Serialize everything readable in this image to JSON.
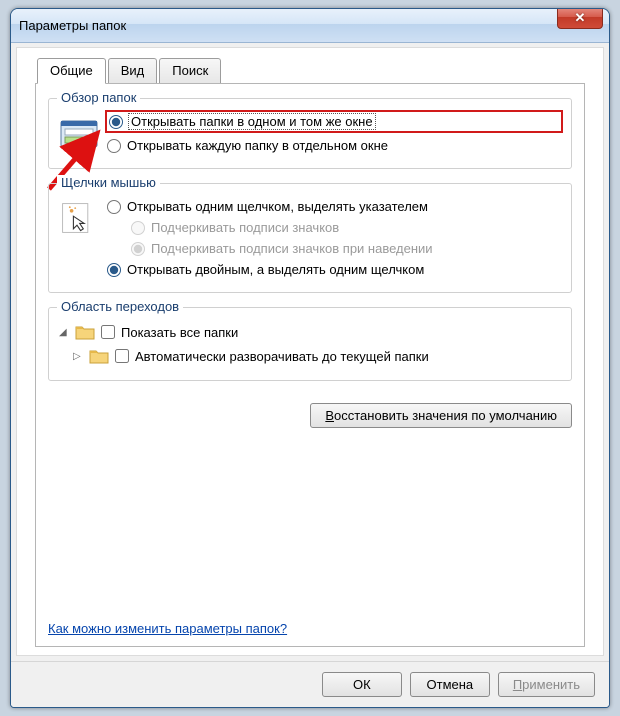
{
  "window": {
    "title": "Параметры папок"
  },
  "tabs": {
    "general": "Общие",
    "view": "Вид",
    "search": "Поиск"
  },
  "group1": {
    "title": "Обзор папок",
    "opt1": "Открывать папки в одном и том же окне",
    "opt2": "Открывать каждую папку в отдельном окне"
  },
  "group2": {
    "title": "Щелчки мышью",
    "opt1": "Открывать одним щелчком, выделять указателем",
    "opt1a": "Подчеркивать подписи значков",
    "opt1b": "Подчеркивать подписи значков при наведении",
    "opt2": "Открывать двойным, а выделять одним щелчком"
  },
  "group3": {
    "title": "Область переходов",
    "opt1": "Показать все папки",
    "opt2": "Автоматически разворачивать до текущей папки"
  },
  "restore_btn": "Восстановить значения по умолчанию",
  "help_link": "Как можно изменить параметры папок?",
  "buttons": {
    "ok": "ОК",
    "cancel": "Отмена",
    "apply": "Применить"
  }
}
